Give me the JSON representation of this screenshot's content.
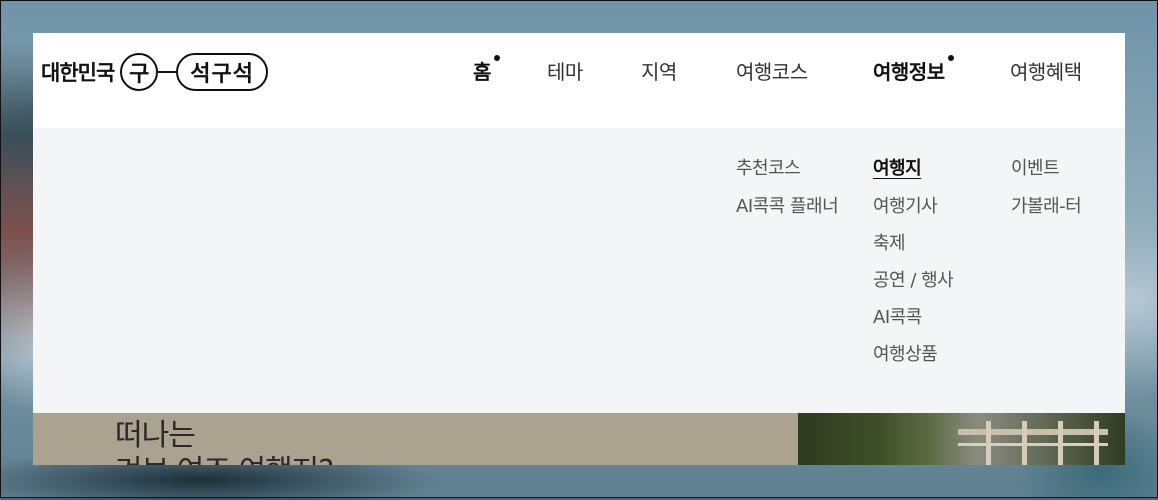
{
  "logo": {
    "text": "대한민국",
    "circle": "구",
    "pill": "석구석"
  },
  "nav": [
    {
      "label": "홈",
      "bold": true,
      "dot": true
    },
    {
      "label": "테마",
      "bold": false,
      "dot": false
    },
    {
      "label": "지역",
      "bold": false,
      "dot": false
    },
    {
      "label": "여행코스",
      "bold": false,
      "dot": false
    },
    {
      "label": "여행정보",
      "bold": true,
      "dot": true
    },
    {
      "label": "여행혜택",
      "bold": false,
      "dot": false
    }
  ],
  "submenu": {
    "col1": [
      "추천코스",
      "AI콕콕 플래너"
    ],
    "col2": [
      "여행지",
      "여행기사",
      "축제",
      "공연 / 행사",
      "AI콕콕",
      "여행상품"
    ],
    "col3": [
      "이벤트",
      "가볼래-터"
    ],
    "active": "여행지"
  },
  "hero": {
    "title_line1": "떠나는",
    "title_line2": "겨보 여즈 여행지?"
  },
  "colors": {
    "dot": "#111111",
    "submenu_bg": "#f4f5f7",
    "hero_bg": "#aba38f"
  }
}
